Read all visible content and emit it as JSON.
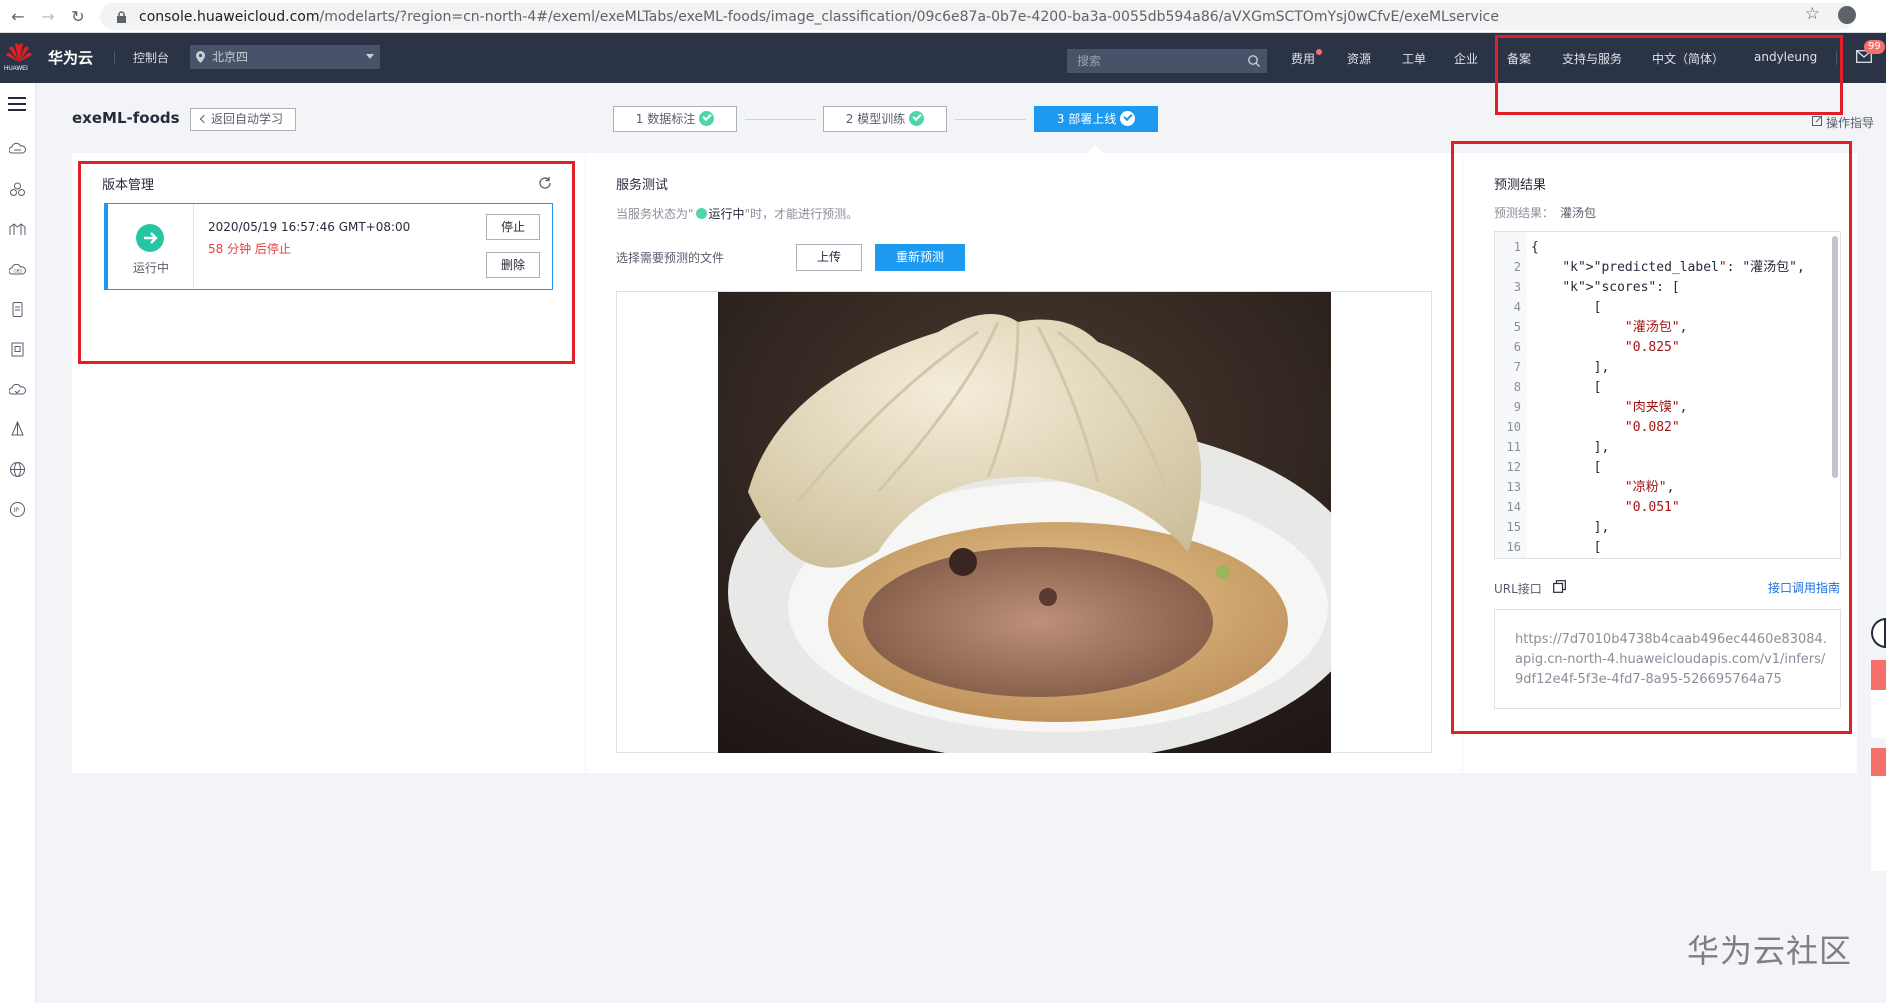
{
  "browser": {
    "url_host": "console.huaweicloud.com",
    "url_path": "/modelarts/?region=cn-north-4#/exeml/exeMLTabs/exeML-foods/image_classification/09c6e87a-0b7e-4200-ba3a-0055db594a86/aVXGmSCTOmYsj0wCfvE/exeMLservice"
  },
  "topnav": {
    "brand_small": "HUAWEI",
    "brand": "华为云",
    "console": "控制台",
    "region": "北京四",
    "search_placeholder": "搜索",
    "items": [
      "费用",
      "资源",
      "工单",
      "企业",
      "备案",
      "支持与服务",
      "中文（简体）",
      "andyleung"
    ],
    "mail_badge": "99"
  },
  "page": {
    "title": "exeML-foods",
    "back": "返回自动学习",
    "guide": "操作指导",
    "steps": [
      {
        "label": "1 数据标注"
      },
      {
        "label": "2 模型训练"
      },
      {
        "label": "3 部署上线"
      }
    ]
  },
  "version_panel": {
    "title": "版本管理",
    "status": "运行中",
    "time": "2020/05/19 16:57:46 GMT+08:00",
    "stop_info": "58 分钟 后停止",
    "stop_btn": "停止",
    "delete_btn": "删除"
  },
  "service_panel": {
    "title": "服务测试",
    "hint_pre": "当服务状态为\"",
    "hint_run": "运行中",
    "hint_post": "\"时，才能进行预测。",
    "choose_file": "选择需要预测的文件",
    "upload": "上传",
    "repredict": "重新预测"
  },
  "result_panel": {
    "title": "预测结果",
    "result_label": "预测结果：",
    "result_value": "灌汤包",
    "code_lines": [
      {
        "n": "1",
        "t": "{"
      },
      {
        "n": "2",
        "t": "    \"predicted_label\": \"灌汤包\","
      },
      {
        "n": "3",
        "t": "    \"scores\": ["
      },
      {
        "n": "4",
        "t": "        ["
      },
      {
        "n": "5",
        "t": "            \"灌汤包\","
      },
      {
        "n": "6",
        "t": "            \"0.825\""
      },
      {
        "n": "7",
        "t": "        ],"
      },
      {
        "n": "8",
        "t": "        ["
      },
      {
        "n": "9",
        "t": "            \"肉夹馍\","
      },
      {
        "n": "10",
        "t": "            \"0.082\""
      },
      {
        "n": "11",
        "t": "        ],"
      },
      {
        "n": "12",
        "t": "        ["
      },
      {
        "n": "13",
        "t": "            \"凉粉\","
      },
      {
        "n": "14",
        "t": "            \"0.051\""
      },
      {
        "n": "15",
        "t": "        ],"
      },
      {
        "n": "16",
        "t": "        ["
      }
    ],
    "url_label": "URL接口",
    "api_guide": "接口调用指南",
    "url_value": "https://7d7010b4738b4caab496ec4460e83084.apig.cn-north-4.huaweicloudapis.com/v1/infers/9df12e4f-5f3e-4fd7-8a95-526695764a75"
  },
  "watermark": "华为云社区",
  "colors": {
    "topnav_bg": "#2b3446",
    "primary": "#1e99f0",
    "success": "#50d4ab",
    "annotation_red": "#e21f26",
    "danger_text": "#e84040"
  }
}
